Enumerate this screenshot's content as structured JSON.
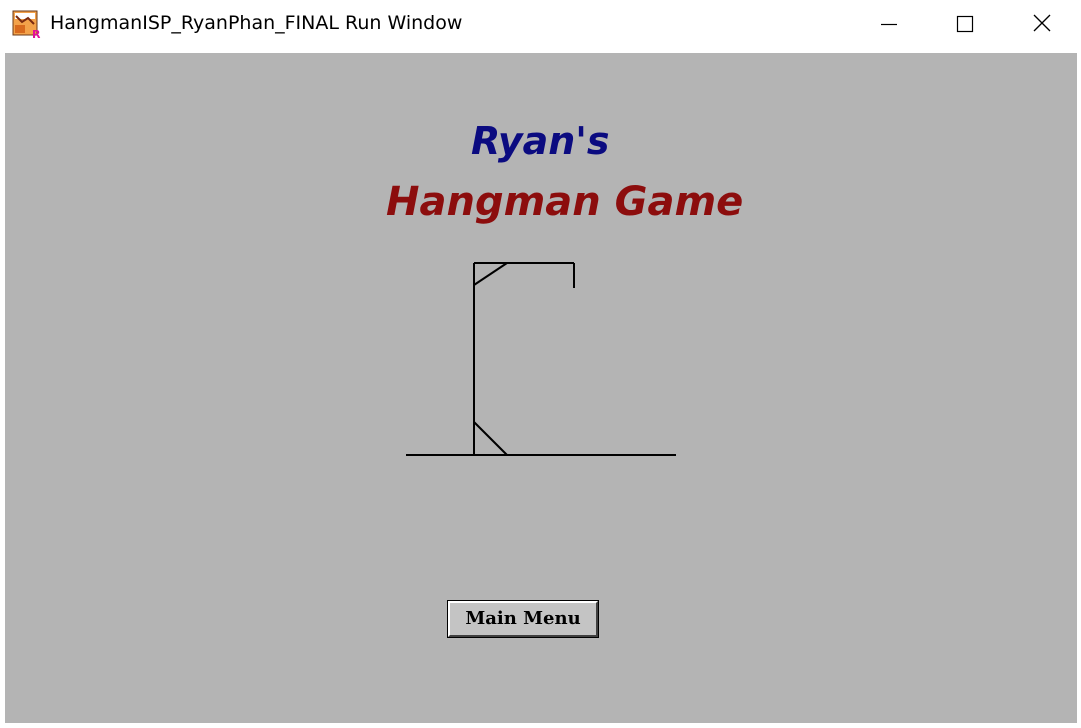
{
  "window": {
    "title": "HangmanISP_RyanPhan_FINAL Run Window",
    "app_icon": "turing-app-icon",
    "controls": {
      "minimize_icon": "minimize-icon",
      "maximize_icon": "maximize-icon",
      "close_icon": "close-icon"
    }
  },
  "content": {
    "heading_line1": "Ryan's",
    "heading_line2": "Hangman Game",
    "main_menu_label": "Main Menu"
  },
  "colors": {
    "canvas_background": "#b4b4b4",
    "heading_line1": "#0b0b80",
    "heading_line2": "#8c0d0d"
  }
}
